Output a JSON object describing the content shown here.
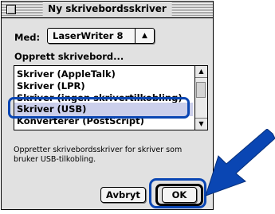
{
  "window": {
    "title": "Ny skrivebordsskriver"
  },
  "printer_type": {
    "label": "Med:",
    "selected": "LaserWriter 8"
  },
  "create_section": {
    "label": "Opprett skrivebord...",
    "items": [
      "Skriver (AppleTalk)",
      "Skriver (LPR)",
      "Skriver (ingen skrivertilkobling)",
      "Skriver (USB)",
      "Konverterer (PostScript)"
    ],
    "selected_index": 3
  },
  "description": "Oppretter skrivebordsskriver for skriver som bruker USB-tilkobling.",
  "buttons": {
    "cancel": "Avbryt",
    "ok": "OK"
  },
  "annotation": {
    "highlight_color": "#0a46b3",
    "arrow_color": "#0a46b3"
  }
}
